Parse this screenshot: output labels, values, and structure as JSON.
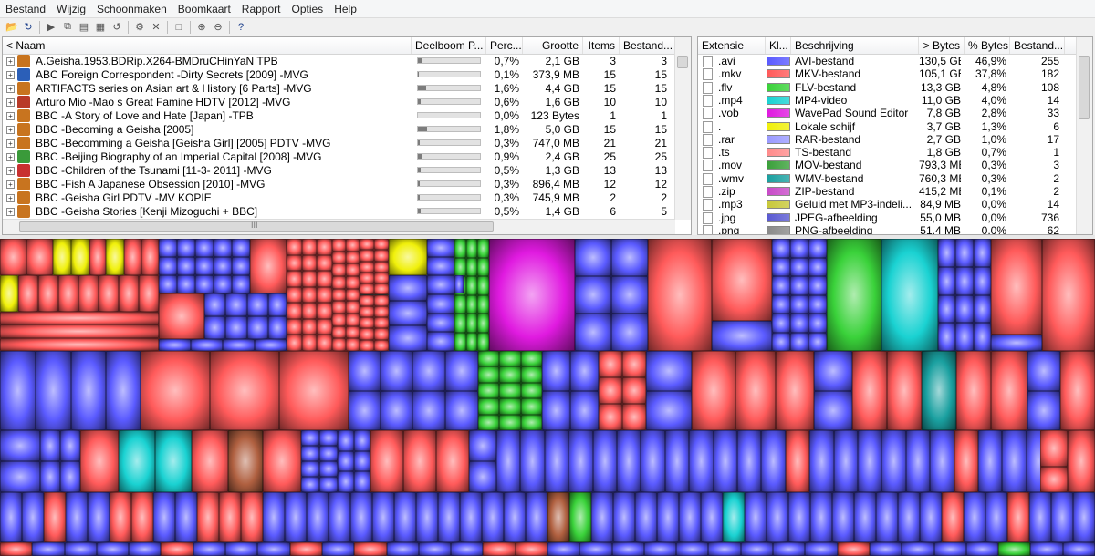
{
  "menu": [
    "Bestand",
    "Wijzig",
    "Schoonmaken",
    "Boomkaart",
    "Rapport",
    "Opties",
    "Help"
  ],
  "toolbar": {
    "buttons": [
      "open-icon",
      "refresh-icon",
      "play-icon",
      "copy-icon",
      "copy-path-icon",
      "explorer-icon",
      "rescan-icon",
      "cleanup-icon",
      "delete-icon",
      "folder-icon",
      "zoom-in-icon",
      "zoom-out-icon",
      "help-icon"
    ]
  },
  "left": {
    "headers": [
      "< Naam",
      "Deelboom P...",
      "Perc...",
      "Grootte",
      "Items",
      "Bestand..."
    ],
    "rows": [
      {
        "name": "A.Geisha.1953.BDRip.X264-BMDruCHinYaN TPB",
        "perc": "0,7%",
        "size": "2,1 GB",
        "items": "3",
        "files": "3",
        "bar": 0.7,
        "icon": "#c8741f"
      },
      {
        "name": "ABC Foreign Correspondent -Dirty Secrets [2009] -MVG",
        "perc": "0,1%",
        "size": "373,9 MB",
        "items": "15",
        "files": "15",
        "bar": 0.1,
        "icon": "#2b5fb8"
      },
      {
        "name": "ARTIFACTS series on Asian art & History [6 Parts] -MVG",
        "perc": "1,6%",
        "size": "4,4 GB",
        "items": "15",
        "files": "15",
        "bar": 1.6,
        "icon": "#c8741f"
      },
      {
        "name": "Arturo Mio -Mao s Great Famine HDTV [2012] -MVG",
        "perc": "0,6%",
        "size": "1,6 GB",
        "items": "10",
        "files": "10",
        "bar": 0.6,
        "icon": "#b83a28"
      },
      {
        "name": "BBC -A Story of Love and Hate [Japan] -TPB",
        "perc": "0,0%",
        "size": "123 Bytes",
        "items": "1",
        "files": "1",
        "bar": 0.0,
        "icon": "#c8741f"
      },
      {
        "name": "BBC -Becoming a Geisha [2005]",
        "perc": "1,8%",
        "size": "5,0 GB",
        "items": "15",
        "files": "15",
        "bar": 1.8,
        "icon": "#c8741f"
      },
      {
        "name": "BBC -Becomming a Geisha [Geisha Girl] [2005] PDTV -MVG",
        "perc": "0,3%",
        "size": "747,0 MB",
        "items": "21",
        "files": "21",
        "bar": 0.3,
        "icon": "#c8741f"
      },
      {
        "name": "BBC -Beijing Biography of an Imperial Capital [2008] -MVG",
        "perc": "0,9%",
        "size": "2,4 GB",
        "items": "25",
        "files": "25",
        "bar": 0.9,
        "icon": "#3a9a3a"
      },
      {
        "name": "BBC -Children of the Tsunami [11-3- 2011] -MVG",
        "perc": "0,5%",
        "size": "1,3 GB",
        "items": "13",
        "files": "13",
        "bar": 0.5,
        "icon": "#c83030"
      },
      {
        "name": "BBC -Fish A Japanese Obsession [2010] -MVG",
        "perc": "0,3%",
        "size": "896,4 MB",
        "items": "12",
        "files": "12",
        "bar": 0.3,
        "icon": "#c8741f"
      },
      {
        "name": "BBC -Geisha Girl PDTV -MV KOPIE",
        "perc": "0,3%",
        "size": "745,9 MB",
        "items": "2",
        "files": "2",
        "bar": 0.3,
        "icon": "#c8741f"
      },
      {
        "name": "BBC -Geisha Stories [Kenji Mizoguchi + BBC]",
        "perc": "0,5%",
        "size": "1,4 GB",
        "items": "6",
        "files": "5",
        "bar": 0.5,
        "icon": "#c8741f"
      }
    ],
    "hscroll_grip": "III"
  },
  "right": {
    "headers": [
      "Extensie",
      "Kl...",
      "Beschrijving",
      "> Bytes",
      "% Bytes",
      "Bestand..."
    ],
    "rows": [
      {
        "ext": ".avi",
        "color": "#5a5aff",
        "desc": "AVI-bestand",
        "bytes": "130,5 GB",
        "pct": "46,9%",
        "files": "255"
      },
      {
        "ext": ".mkv",
        "color": "#ff5a5a",
        "desc": "MKV-bestand",
        "bytes": "105,1 GB",
        "pct": "37,8%",
        "files": "182"
      },
      {
        "ext": ".flv",
        "color": "#3ad23a",
        "desc": "FLV-bestand",
        "bytes": "13,3 GB",
        "pct": "4,8%",
        "files": "108"
      },
      {
        "ext": ".mp4",
        "color": "#1ad2d2",
        "desc": "MP4-video",
        "bytes": "11,0 GB",
        "pct": "4,0%",
        "files": "14"
      },
      {
        "ext": ".vob",
        "color": "#e01ae0",
        "desc": "WavePad Sound Editor",
        "bytes": "7,8 GB",
        "pct": "2,8%",
        "files": "33"
      },
      {
        "ext": ".",
        "color": "#f0f00a",
        "desc": "Lokale schijf",
        "bytes": "3,7 GB",
        "pct": "1,3%",
        "files": "6"
      },
      {
        "ext": ".rar",
        "color": "#9a9aff",
        "desc": "RAR-bestand",
        "bytes": "2,7 GB",
        "pct": "1,0%",
        "files": "17"
      },
      {
        "ext": ".ts",
        "color": "#ff8c8c",
        "desc": "TS-bestand",
        "bytes": "1,8 GB",
        "pct": "0,7%",
        "files": "1"
      },
      {
        "ext": ".mov",
        "color": "#3aa03a",
        "desc": "MOV-bestand",
        "bytes": "793,3 MB",
        "pct": "0,3%",
        "files": "3"
      },
      {
        "ext": ".wmv",
        "color": "#1aa0a0",
        "desc": "WMV-bestand",
        "bytes": "760,3 MB",
        "pct": "0,3%",
        "files": "2"
      },
      {
        "ext": ".zip",
        "color": "#c84ac8",
        "desc": "ZIP-bestand",
        "bytes": "415,2 MB",
        "pct": "0,1%",
        "files": "2"
      },
      {
        "ext": ".mp3",
        "color": "#c8c83a",
        "desc": "Geluid met MP3-indeli...",
        "bytes": "84,9 MB",
        "pct": "0,0%",
        "files": "14"
      },
      {
        "ext": ".jpg",
        "color": "#5a5ad2",
        "desc": "JPEG-afbeelding",
        "bytes": "55,0 MB",
        "pct": "0,0%",
        "files": "736"
      },
      {
        "ext": ".png",
        "color": "#8a8a8a",
        "desc": "PNG-afbeelding",
        "bytes": "51,4 MB",
        "pct": "0,0%",
        "files": "62"
      }
    ]
  },
  "treemap": {
    "colors": {
      "blue": "#5a5aff",
      "red": "#ff5a5a",
      "green": "#3ad23a",
      "cyan": "#1ad2d2",
      "magenta": "#e01ae0",
      "yellow": "#f0f00a",
      "darkred": "#c04040",
      "brown": "#b06040",
      "teal": "#1aa0a0"
    }
  }
}
